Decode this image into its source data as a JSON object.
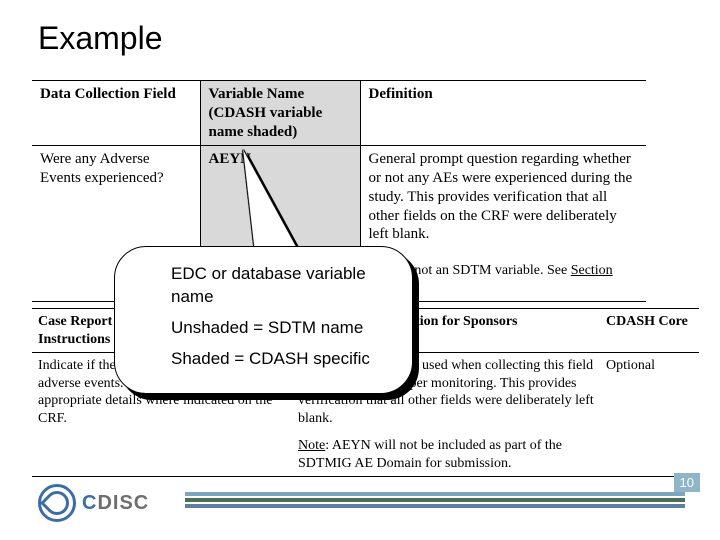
{
  "title": "Example",
  "table1": {
    "header": {
      "field": "Data Collection Field",
      "varname": "Variable Name (CDASH variable name shaded)",
      "definition": "Definition"
    },
    "row": {
      "field": "Were any Adverse Events experienced?",
      "varname": "AEYN",
      "definition": "General prompt question regarding whether or not any AEs were experienced during the study. This provides verification that all other fields on the CRF were deliberately left blank.",
      "sdtm_note_prefix": "(This is not an SDTM variable. See ",
      "sdtm_note_link": "Section 2.2",
      "sdtm_note_suffix": ".)"
    }
  },
  "table2": {
    "header": {
      "crf": "Case Report Form Completion Instructions",
      "sponsor": "Additional Information for Sponsors",
      "core": "CDASH Core"
    },
    "row": {
      "crf": "Indicate if the subject experienced any adverse events. If yes, include the appropriate details where indicated on the CRF.",
      "sponsor_p1": "This is intended to be used when collecting this field is preferable for proper monitoring. This provides verification that all other fields were deliberately left blank.",
      "sponsor_note_label": "Note",
      "sponsor_note_rest": ": AEYN will not be included as part of the SDTMIG AE Domain for submission.",
      "core": "Optional"
    }
  },
  "callout": {
    "line1": "EDC or database variable name",
    "line2": "Unshaded = SDTM name",
    "line3": "Shaded = CDASH specific"
  },
  "footer": {
    "page": "10",
    "logo_c": "C",
    "logo_rest": "DISC"
  }
}
